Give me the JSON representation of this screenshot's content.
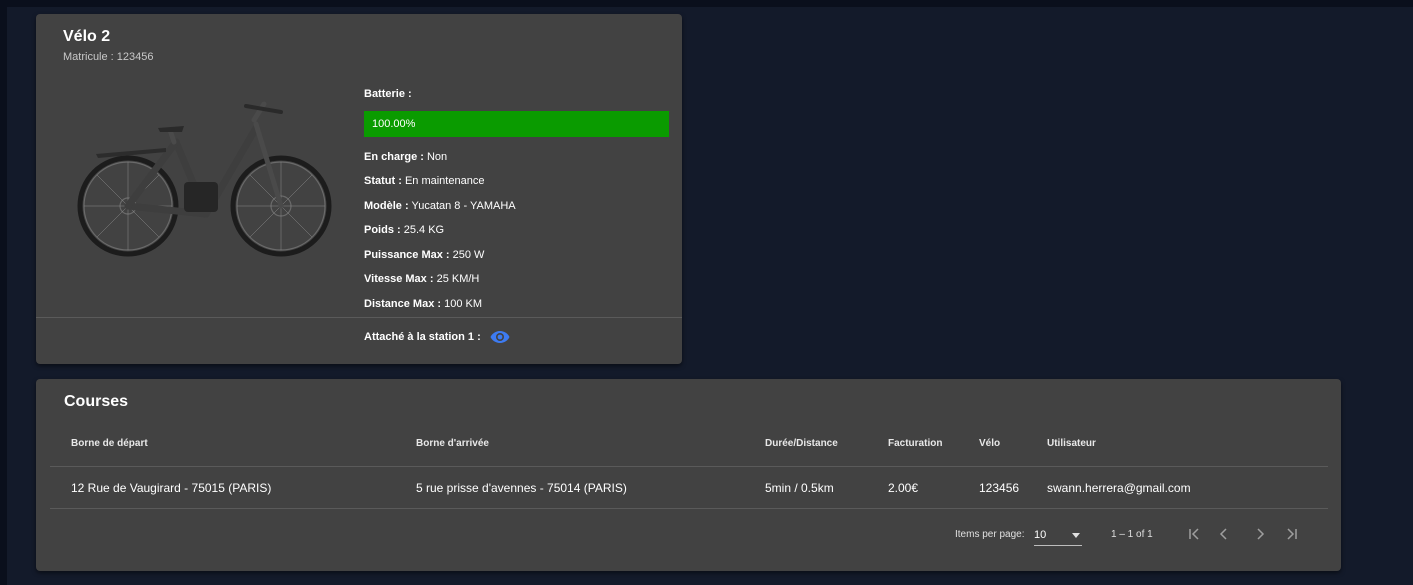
{
  "bike": {
    "title": "Vélo 2",
    "matricule": "Matricule : 123456",
    "battery_label": "Batterie :",
    "battery_percent": 100,
    "battery_text": "100.00%",
    "details": [
      {
        "label": "En charge :",
        "value": " Non"
      },
      {
        "label": "Statut :",
        "value": " En maintenance"
      },
      {
        "label": "Modèle :",
        "value": " Yucatan 8 - YAMAHA"
      },
      {
        "label": "Poids :",
        "value": " 25.4 KG"
      },
      {
        "label": "Puissance Max :",
        "value": " 250 W"
      },
      {
        "label": "Vitesse Max :",
        "value": " 25 KM/H"
      },
      {
        "label": "Distance Max :",
        "value": " 100 KM"
      }
    ],
    "station_label": "Attaché à la station 1 :",
    "station_icon": "eye-icon"
  },
  "courses": {
    "title": "Courses",
    "columns": [
      "Borne de départ",
      "Borne d'arrivée",
      "Durée/Distance",
      "Facturation",
      "Vélo",
      "Utilisateur"
    ],
    "rows": [
      [
        "12 Rue de Vaugirard - 75015 (PARIS)",
        "5 rue prisse d'avennes - 75014 (PARIS)",
        "5min / 0.5km",
        "2.00€",
        "123456",
        "swann.herrera@gmail.com"
      ]
    ],
    "paginator": {
      "items_per_page_label": "Items per page:",
      "items_per_page_value": "10",
      "range": "1 – 1 of 1"
    }
  },
  "colors": {
    "battery": "#0a9b00",
    "eye": "#3d7bf2",
    "card": "#424242",
    "background": "#131a2a"
  }
}
